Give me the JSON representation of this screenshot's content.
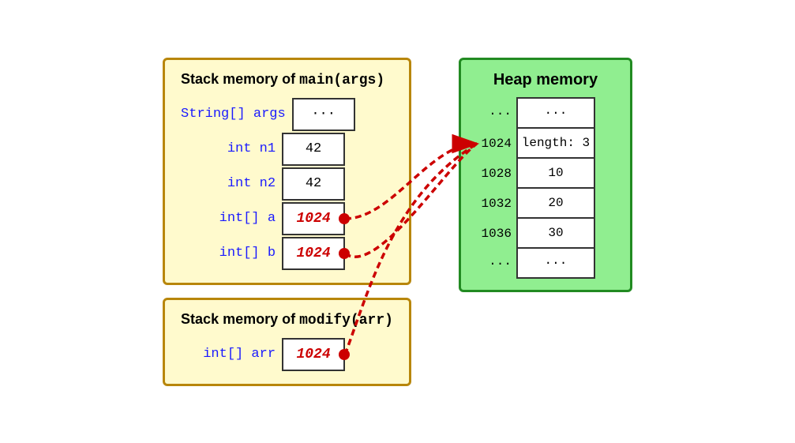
{
  "main_stack": {
    "title_text": "Stack memory",
    "title_code": "main(args)",
    "rows": [
      {
        "label": "String[] args",
        "value": "···",
        "is_pointer": false
      },
      {
        "label": "int n1",
        "value": "42",
        "is_pointer": false
      },
      {
        "label": "int n2",
        "value": "42",
        "is_pointer": false
      },
      {
        "label": "int[] a",
        "value": "1024",
        "is_pointer": true
      },
      {
        "label": "int[] b",
        "value": "1024",
        "is_pointer": true
      }
    ]
  },
  "modify_stack": {
    "title_text": "Stack memory",
    "title_code": "modify(arr)",
    "rows": [
      {
        "label": "int[] arr",
        "value": "1024",
        "is_pointer": true
      }
    ]
  },
  "heap": {
    "title": "Heap memory",
    "rows": [
      {
        "addr": "···",
        "value": "···"
      },
      {
        "addr": "1024",
        "value": "length: 3"
      },
      {
        "addr": "1028",
        "value": "10"
      },
      {
        "addr": "1032",
        "value": "20"
      },
      {
        "addr": "1036",
        "value": "30"
      },
      {
        "addr": "···",
        "value": "···"
      }
    ]
  },
  "arrow": {
    "label": "pointer arrow from stack to heap"
  }
}
